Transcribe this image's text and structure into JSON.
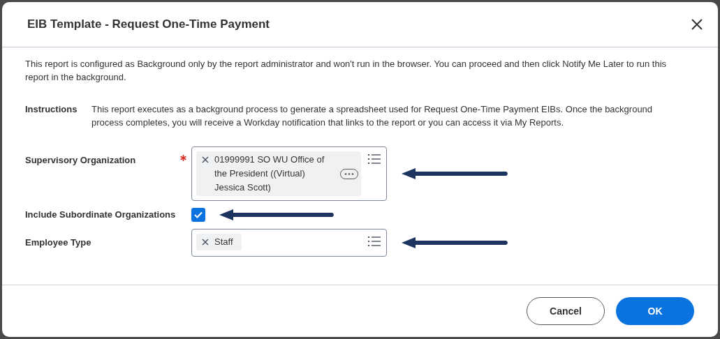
{
  "dialog": {
    "title": "EIB Template - Request One-Time Payment"
  },
  "notice": "This report is configured as Background only by the report administrator and won't run in the browser. You can proceed and then click Notify Me Later to run this report in the background.",
  "instructions": {
    "label": "Instructions",
    "text": "This report executes as a background process to generate a spreadsheet used for Request One-Time Payment EIBs. Once the background process completes, you will receive a Workday notification that links to the report or you can access it via My Reports."
  },
  "fields": [
    {
      "kind": "prompt",
      "label": "Supervisory Organization",
      "required": true,
      "tokens": [
        {
          "text": "01999991 SO WU Office of the President ((Virtual) Jessica Scott)",
          "related_actions": true
        }
      ]
    },
    {
      "kind": "checkbox",
      "label": "Include Subordinate Organizations",
      "checked": true
    },
    {
      "kind": "prompt",
      "label": "Employee Type",
      "required": false,
      "tokens": [
        {
          "text": "Staff",
          "related_actions": false
        }
      ]
    }
  ],
  "buttons": [
    {
      "label": "Cancel",
      "kind": "secondary"
    },
    {
      "label": "OK",
      "kind": "primary"
    }
  ]
}
